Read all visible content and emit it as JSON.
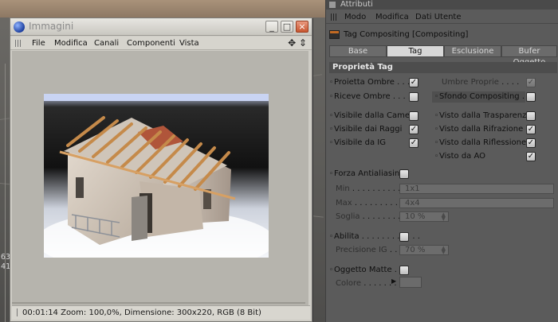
{
  "image_window": {
    "title": "Immagini",
    "menu": [
      "File",
      "Modifica",
      "Canali",
      "Componenti",
      "Vista"
    ],
    "controls": {
      "minimize": "_",
      "maximize": "□",
      "close": "×"
    },
    "status": "00:01:14  Zoom: 100,0%, Dimensione: 300x220, RGB (8 Bit)"
  },
  "attributes": {
    "window_title": "Attributi",
    "menu": [
      "Modo",
      "Modifica",
      "Dati Utente"
    ],
    "object_title": "Tag Compositing [Compositing]",
    "tabs": [
      {
        "label": "Base",
        "active": false
      },
      {
        "label": "Tag",
        "active": true
      },
      {
        "label": "Esclusione",
        "active": false
      },
      {
        "label": "Bufer Oggetto",
        "active": false
      }
    ],
    "section": "Proprietà Tag",
    "props": {
      "proietta_ombre": {
        "label": "Proietta Ombre",
        "checked": true
      },
      "riceve_ombre": {
        "label": "Riceve Ombre",
        "checked": false
      },
      "umbre_proprie": {
        "label": "Umbre Proprie",
        "checked": true,
        "disabled": true
      },
      "sfondo_compositing": {
        "label": "Sfondo Compositing",
        "checked": false
      },
      "visibile_camera": {
        "label": "Visibile dalla Camera",
        "checked": false
      },
      "visibile_raggi": {
        "label": "Visibile dai Raggi",
        "checked": true
      },
      "visibile_ig": {
        "label": "Visibile da IG",
        "checked": true
      },
      "visto_trasparenza": {
        "label": "Visto dalla Trasparenza",
        "checked": false
      },
      "visto_rifrazione": {
        "label": "Visto dalla Rifrazione",
        "checked": true
      },
      "visto_riflessione": {
        "label": "Visto dalla Riflessione",
        "checked": true
      },
      "visto_ao": {
        "label": "Visto da AO",
        "checked": true
      },
      "forza_antialiasing": {
        "label": "Forza Antialiasing",
        "checked": false
      },
      "min": {
        "label": "Min",
        "value": "1x1"
      },
      "max": {
        "label": "Max",
        "value": "4x4"
      },
      "soglia": {
        "label": "Soglia",
        "value": "10 %"
      },
      "abilita": {
        "label": "Abilita",
        "checked": false
      },
      "precisione_ig": {
        "label": "Precisione IG",
        "value": "70 %"
      },
      "oggetto_matte": {
        "label": "Oggetto Matte",
        "checked": false
      },
      "colore": {
        "label": "Colore"
      }
    }
  },
  "viewport": {
    "edge_labels": [
      "63",
      "41"
    ]
  }
}
